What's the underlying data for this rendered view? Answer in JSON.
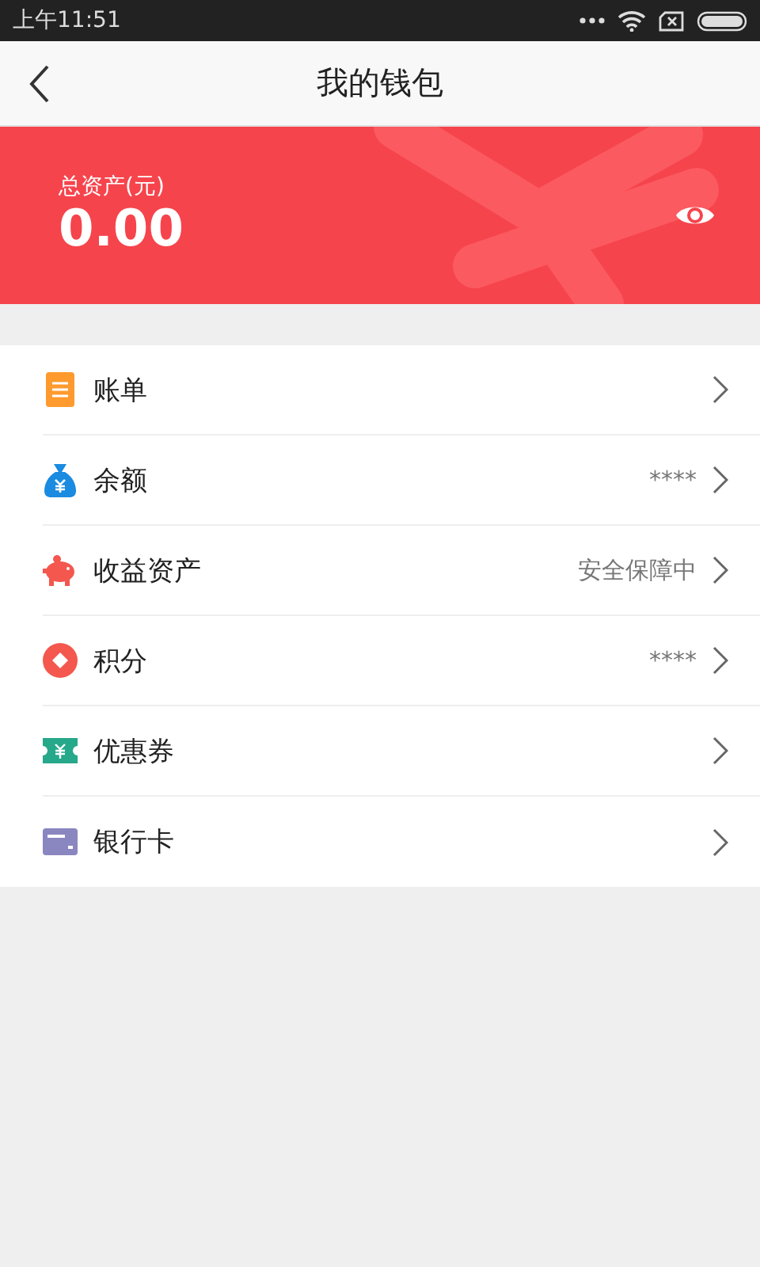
{
  "status_bar": {
    "time": "上午11:51"
  },
  "nav": {
    "title": "我的钱包"
  },
  "assets": {
    "label": "总资产(元)",
    "amount": "0.00"
  },
  "items": [
    {
      "kind": "bill",
      "label": "账单"
    },
    {
      "kind": "balance",
      "label": "余额",
      "value": "****"
    },
    {
      "kind": "savings",
      "label": "收益资产",
      "value": "安全保障中"
    },
    {
      "kind": "points",
      "label": "积分",
      "value": "****"
    },
    {
      "kind": "coupon",
      "label": "优惠券"
    },
    {
      "kind": "card",
      "label": "银行卡"
    }
  ]
}
